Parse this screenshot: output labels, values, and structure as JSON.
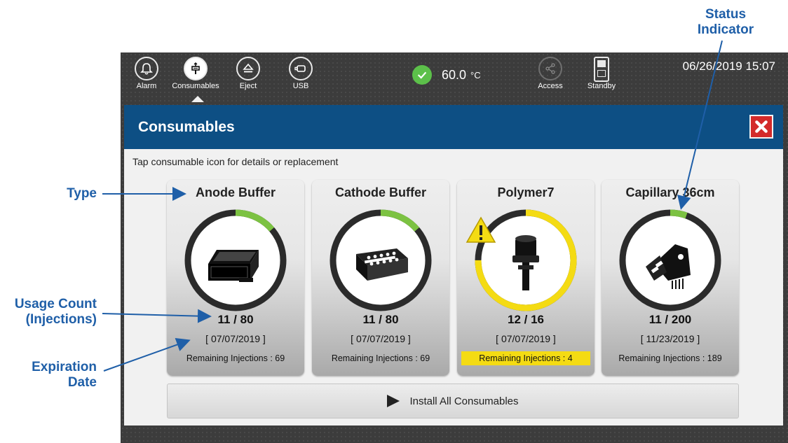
{
  "annotations": {
    "status_indicator": [
      "Status",
      "Indicator"
    ],
    "type": "Type",
    "usage_count": [
      "Usage Count",
      "(Injections)"
    ],
    "expiration_date": [
      "Expiration",
      "Date"
    ]
  },
  "toolbar": {
    "items": [
      {
        "label": "Alarm",
        "icon": "bell-icon"
      },
      {
        "label": "Consumables",
        "icon": "consumables-icon",
        "active": true
      },
      {
        "label": "Eject",
        "icon": "eject-icon"
      },
      {
        "label": "USB",
        "icon": "usb-icon"
      }
    ],
    "temperature": "60.0",
    "temperature_unit": "°C",
    "access_label": "Access",
    "standby_label": "Standby",
    "datetime": "06/26/2019 15:07"
  },
  "panel": {
    "title": "Consumables",
    "hint": "Tap consumable icon for details or replacement",
    "install_all_label": "Install All Consumables"
  },
  "cards": [
    {
      "name": "Anode Buffer",
      "usage": "11 / 80",
      "expiration": "[ 07/07/2019 ]",
      "remaining": "Remaining Injections : 69",
      "used_fraction": 0.1375,
      "status": "ok"
    },
    {
      "name": "Cathode Buffer",
      "usage": "11 / 80",
      "expiration": "[ 07/07/2019 ]",
      "remaining": "Remaining Injections : 69",
      "used_fraction": 0.1375,
      "status": "ok"
    },
    {
      "name": "Polymer7",
      "usage": "12 / 16",
      "expiration": "[ 07/07/2019 ]",
      "remaining": "Remaining Injections : 4",
      "used_fraction": 0.75,
      "status": "warning"
    },
    {
      "name": "Capillary 36cm",
      "usage": "11 / 200",
      "expiration": "[ 11/23/2019 ]",
      "remaining": "Remaining Injections : 189",
      "used_fraction": 0.055,
      "status": "ok"
    }
  ],
  "colors": {
    "header": "#0d4f84",
    "ok_ring": "#7cc242",
    "warn_ring": "#f4db13",
    "callout": "#1f5fa8",
    "close": "#d32a2a"
  }
}
